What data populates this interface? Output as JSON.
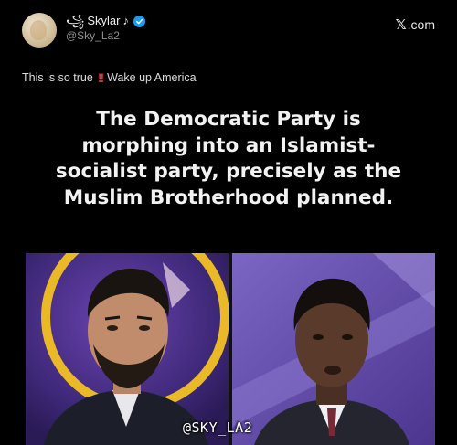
{
  "post": {
    "display_name": "Skylar",
    "handle": "@Sky_La2",
    "source_site": ".com",
    "caption_text": "This is so true",
    "caption_emphasis": "!!",
    "caption_tail": "Wake up America"
  },
  "meme": {
    "headline_lines": [
      "The Democratic Party is",
      "morphing into an Islamist-",
      "socialist party, precisely as the",
      "Muslim Brotherhood planned."
    ],
    "watermark": "@SKY_LA2"
  },
  "colors": {
    "background": "#000000",
    "verified_badge": "#1d9bf0",
    "emphasis": "#e8323c",
    "backdrop_left": "#4a2c8c",
    "backdrop_right": "#6a4fb8"
  },
  "icons": {
    "verified": "verified-badge-icon",
    "site_logo": "x-logo-icon"
  }
}
